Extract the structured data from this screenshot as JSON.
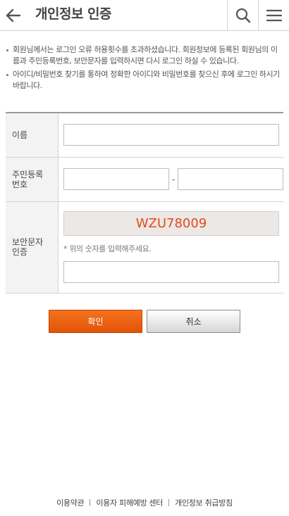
{
  "header": {
    "title": "개인정보 인증",
    "back_icon": "arrow-left-icon",
    "search_icon": "search-icon",
    "menu_icon": "hamburger-menu-icon"
  },
  "notices": [
    "회원님께서는 로그인 오류 허용횟수를 초과하셨습니다. 회원정보에 등록된 회원님의 이름과 주민등록번호, 보안문자를 입력하시면 다시 로그인 하실 수 있습니다.",
    "아이디/비밀번호 찾기를 통하여 정확한 아이디와 비밀번호를 찾으신 후에 로그인 하시기 바랍니다."
  ],
  "form": {
    "name_label": "이름",
    "name_value": "",
    "ssn_label_1": "주민등록",
    "ssn_label_2": "번호",
    "ssn_front_value": "",
    "ssn_separator": "-",
    "ssn_back_value": "",
    "captcha_label_1": "보안문자",
    "captcha_label_2": "인증",
    "captcha_code": "WZU78009",
    "captcha_hint": "* 위의 숫자를 입력해주세요.",
    "captcha_value": ""
  },
  "buttons": {
    "confirm": "확인",
    "cancel": "취소"
  },
  "footer": {
    "links": [
      "이용약관",
      "이용자 피해예방 센터",
      "개인정보 취급방침"
    ]
  },
  "colors": {
    "accent": "#e85a0c",
    "captcha_text": "#e34a1a"
  }
}
